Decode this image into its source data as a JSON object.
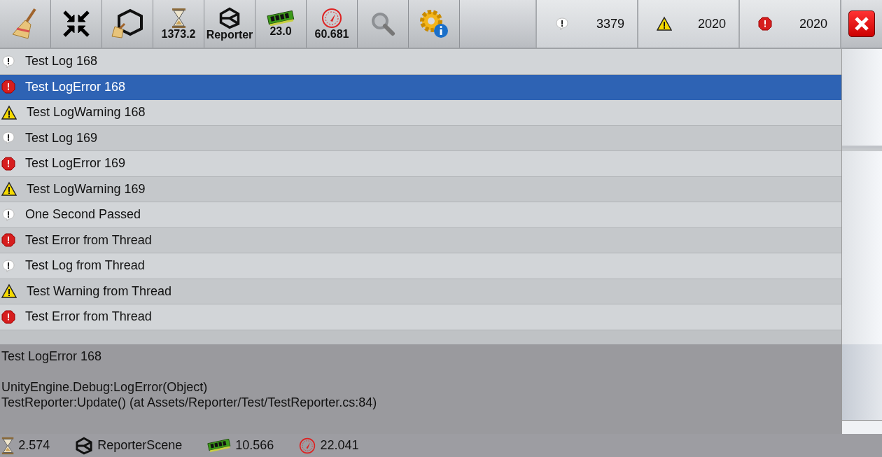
{
  "toolbar": {
    "tools": [
      {
        "kind": "clear"
      },
      {
        "kind": "collapse"
      },
      {
        "kind": "clear-on-scene"
      },
      {
        "kind": "time",
        "label": "1373.2"
      },
      {
        "kind": "scene",
        "label": "Reporter"
      },
      {
        "kind": "memory",
        "label": "23.0"
      },
      {
        "kind": "fps",
        "label": "60.681"
      },
      {
        "kind": "search"
      },
      {
        "kind": "info"
      }
    ],
    "counters": [
      {
        "kind": "log",
        "count": "3379"
      },
      {
        "kind": "warning",
        "count": "2020"
      },
      {
        "kind": "error",
        "count": "2020"
      }
    ]
  },
  "logs": [
    {
      "kind": "log",
      "text": "Test Log 168",
      "selected": false
    },
    {
      "kind": "error",
      "text": "Test LogError 168",
      "selected": true
    },
    {
      "kind": "warning",
      "text": "Test LogWarning 168",
      "selected": false
    },
    {
      "kind": "log",
      "text": "Test Log 169",
      "selected": false
    },
    {
      "kind": "error",
      "text": "Test LogError 169",
      "selected": false
    },
    {
      "kind": "warning",
      "text": "Test LogWarning 169",
      "selected": false
    },
    {
      "kind": "log",
      "text": "One Second Passed",
      "selected": false
    },
    {
      "kind": "error",
      "text": "Test Error from Thread",
      "selected": false
    },
    {
      "kind": "log",
      "text": "Test Log from Thread",
      "selected": false
    },
    {
      "kind": "warning",
      "text": "Test Warning from Thread",
      "selected": false
    },
    {
      "kind": "error",
      "text": "Test Error from Thread",
      "selected": false
    }
  ],
  "detail": {
    "message": "Test LogError 168",
    "stack": [
      "UnityEngine.Debug:LogError(Object)",
      "TestReporter:Update() (at Assets/Reporter/Test/TestReporter.cs:84)"
    ]
  },
  "status_bar": [
    {
      "kind": "time",
      "value": "2.574"
    },
    {
      "kind": "scene",
      "value": "ReporterScene"
    },
    {
      "kind": "memory",
      "value": "10.566"
    },
    {
      "kind": "fps",
      "value": "22.041"
    }
  ]
}
